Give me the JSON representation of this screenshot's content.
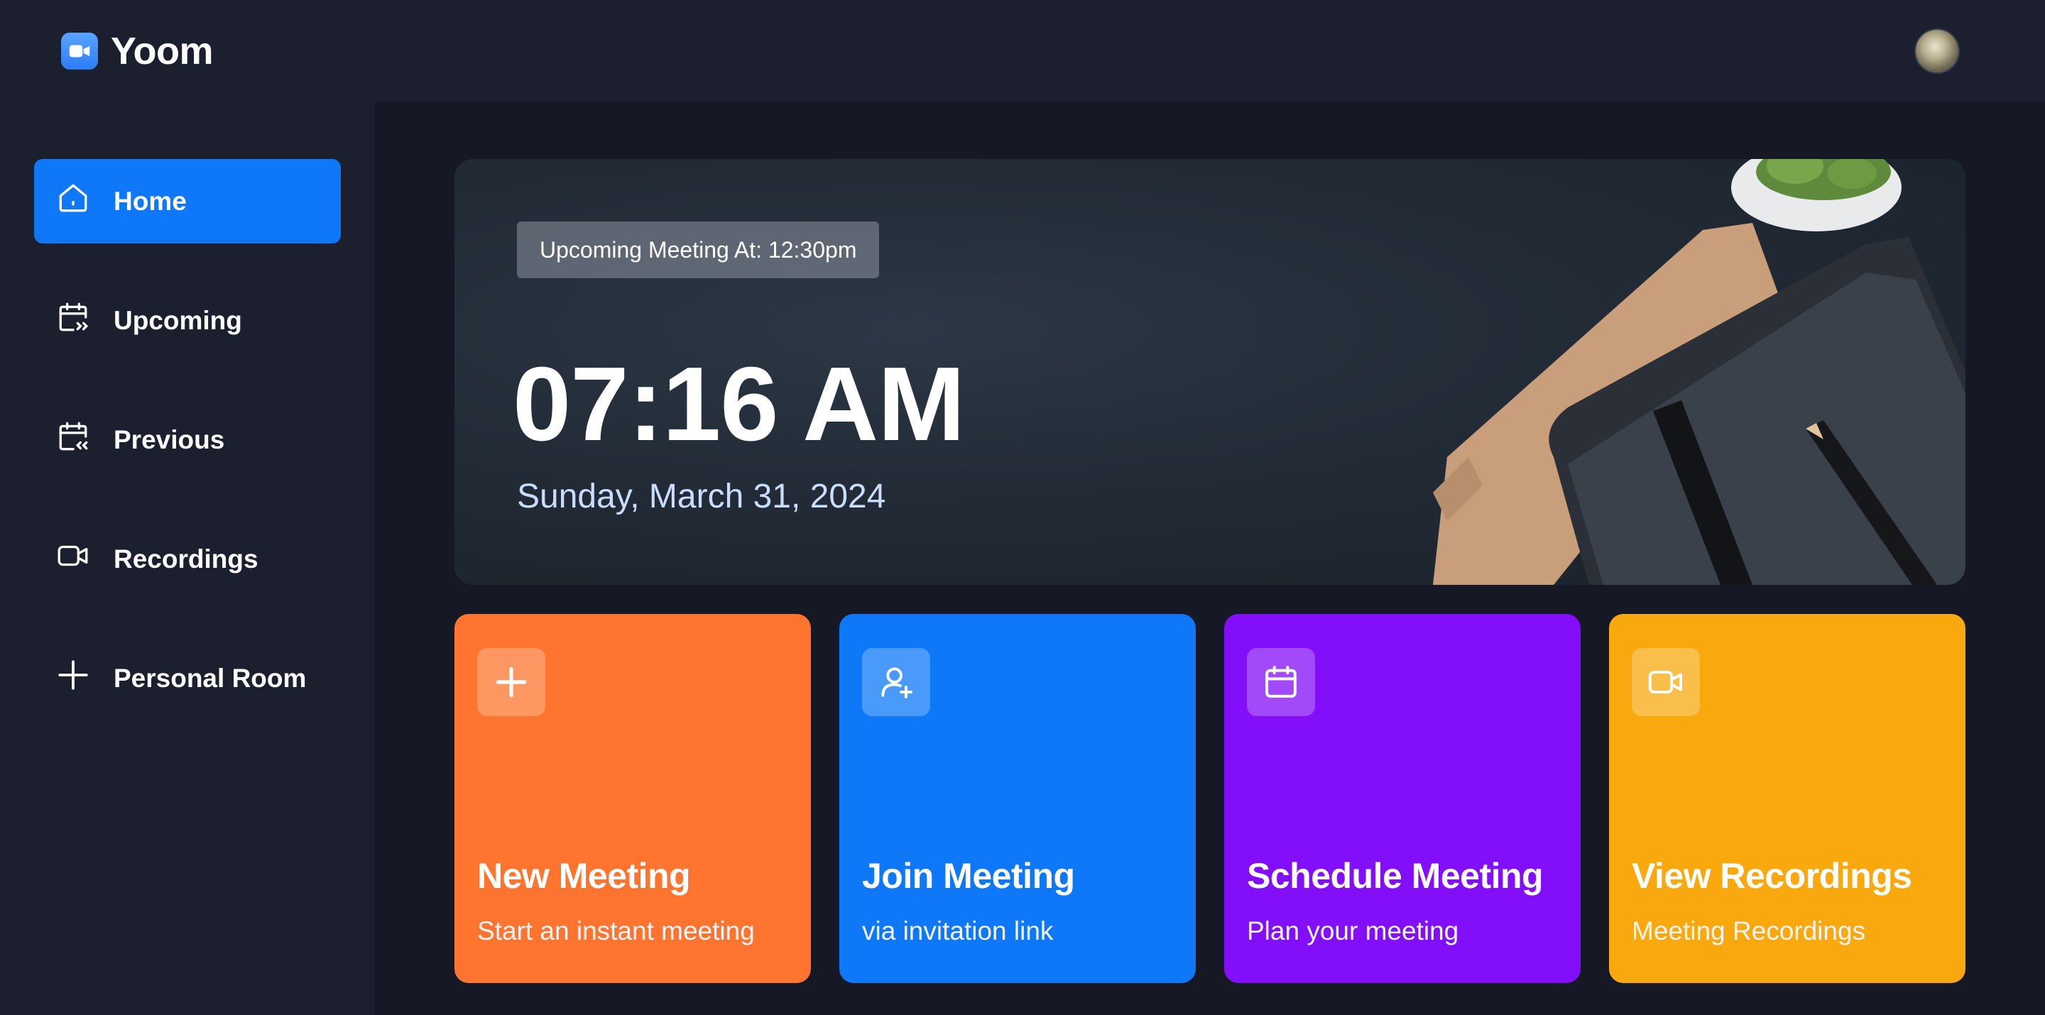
{
  "brand": {
    "name": "Yoom",
    "logo_icon": "video-camera-icon",
    "accent": "#0e78f9"
  },
  "header": {
    "avatar": "user-avatar"
  },
  "sidebar": {
    "items": [
      {
        "label": "Home",
        "icon": "home-icon",
        "active": true
      },
      {
        "label": "Upcoming",
        "icon": "calendar-forward-icon",
        "active": false
      },
      {
        "label": "Previous",
        "icon": "calendar-back-icon",
        "active": false
      },
      {
        "label": "Recordings",
        "icon": "video-icon",
        "active": false
      },
      {
        "label": "Personal Room",
        "icon": "plus-icon",
        "active": false
      }
    ]
  },
  "hero": {
    "badge": "Upcoming Meeting At: 12:30pm",
    "time": "07:16 AM",
    "date": "Sunday, March 31, 2024"
  },
  "cards": [
    {
      "title": "New Meeting",
      "subtitle": "Start an instant meeting",
      "icon": "plus-icon",
      "color": "#ff742e"
    },
    {
      "title": "Join Meeting",
      "subtitle": "via invitation link",
      "icon": "add-user-icon",
      "color": "#0e78f9"
    },
    {
      "title": "Schedule Meeting",
      "subtitle": "Plan your meeting",
      "icon": "calendar-icon",
      "color": "#830ef9"
    },
    {
      "title": "View Recordings",
      "subtitle": "Meeting Recordings",
      "icon": "video-icon",
      "color": "#f9a90e"
    }
  ]
}
